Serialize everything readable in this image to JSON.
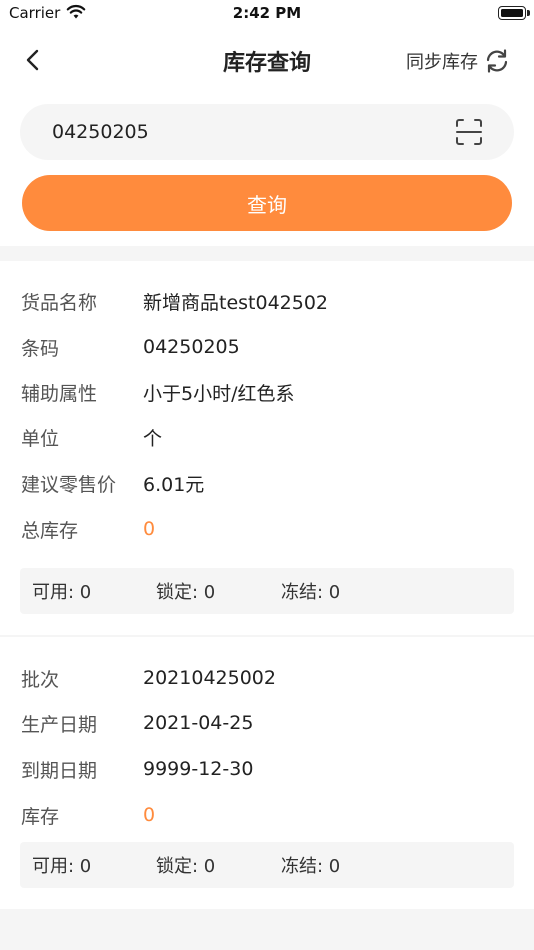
{
  "status_bar": {
    "carrier": "Carrier",
    "time": "2:42 PM"
  },
  "nav": {
    "title": "库存查询",
    "sync_label": "同步库存"
  },
  "search": {
    "value": "04250205",
    "button_label": "查询"
  },
  "product": {
    "rows": [
      {
        "label": "货品名称",
        "value": "新增商品test042502"
      },
      {
        "label": "条码",
        "value": "04250205"
      },
      {
        "label": "辅助属性",
        "value": "小于5小时/红色系"
      },
      {
        "label": "单位",
        "value": "个"
      },
      {
        "label": "建议零售价",
        "value": "6.01元"
      },
      {
        "label": "总库存",
        "value": "0"
      }
    ],
    "stock": {
      "available": "可用: 0",
      "locked": "锁定: 0",
      "frozen": "冻结: 0"
    }
  },
  "batch": {
    "rows": [
      {
        "label": "批次",
        "value": "20210425002"
      },
      {
        "label": "生产日期",
        "value": "2021-04-25"
      },
      {
        "label": "到期日期",
        "value": "9999-12-30"
      },
      {
        "label": "库存",
        "value": "0"
      }
    ],
    "stock": {
      "available": "可用: 0",
      "locked": "锁定: 0",
      "frozen": "冻结: 0"
    }
  },
  "colors": {
    "accent": "#ff8b3d",
    "background": "#f5f5f5"
  },
  "icons": [
    "wifi-icon",
    "battery-icon",
    "back-arrow-icon",
    "sync-icon",
    "scan-icon"
  ]
}
